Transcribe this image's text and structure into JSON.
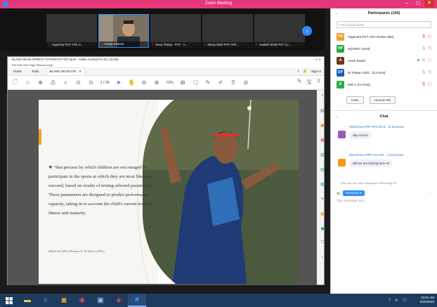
{
  "zoom": {
    "window_title": "Zoom Meeting",
    "recording_label": "Recording...",
    "video_tiles": [
      {
        "name": "Yogendra PGT APS O..."
      },
      {
        "name": "Anoop Sharma"
      },
      {
        "name": "Deep Pratap - PGT - A..."
      },
      {
        "name": "Manju Bisht PGT APS ..."
      },
      {
        "name": "Kailash Bhatt PGT Co..."
      }
    ]
  },
  "pdf": {
    "title": "BLANK DEVELOPMENT PATHWAYS FOR Sport - Adobe Acrobat Pro DC (32-bit)",
    "window_controls": "–  ◻  ✕",
    "menu": "File  Edit  View  Sign  Window  Help",
    "tabs": [
      "Home",
      "Tools",
      "BLANK DEVELOP...  ✕"
    ],
    "sign_in": "Sign In",
    "page_indicator": "1 / 26",
    "zoom_level": "72%",
    "quote": "❖ \"that process by which children are encouraged to participate in the sports at which they are most likely to succeed, based on results of testing selected parameters. These parameters are designed to predict performance capacity, taking in to account the child's current level of fitness and maturity.",
    "citation": "(Bobik H (1995)/ Elomma, K. W/ Davis (2003))"
  },
  "participants": {
    "header": "Participants (104)",
    "search_placeholder": "Find a participant",
    "list": [
      {
        "initials": "YG",
        "name": "Yogendra PGT APS Ovelior (Me)",
        "color": "#f0a030"
      },
      {
        "initials": "HP",
        "name": "HQ-DRC (Host)",
        "color": "#2ca84a"
      },
      {
        "initials": "A",
        "name": "Anish Sinder",
        "color": "#6b3a1e"
      },
      {
        "initials": "DP",
        "name": "Dr Pawan Addi... (Co-host)",
        "color": "#1b5fb0"
      },
      {
        "initials": "D",
        "name": "Mini 1 (Co-host)",
        "color": "#2ca84a"
      }
    ],
    "invite_button": "Invite",
    "unmute_button": "Unmute Me"
  },
  "chat": {
    "header": "Chat",
    "messages": [
      {
        "from": "Rekha Devi PRT APS KD B... to Everyone",
        "text": "day school",
        "avatar_color": "#9b59b6"
      },
      {
        "from": "Dinesh Devi PRT F11 APS ... to Everyone",
        "text": "still we are lacking time sir",
        "avatar_color": "#f39c12"
      }
    ],
    "visibility_note": "Who can see your messages? Recording On",
    "to_label": "To:",
    "to_target": "Everyone ▾",
    "type_placeholder": "Type message here..."
  },
  "taskbar": {
    "time": "10:01 AM",
    "date": "8/10/2020"
  }
}
